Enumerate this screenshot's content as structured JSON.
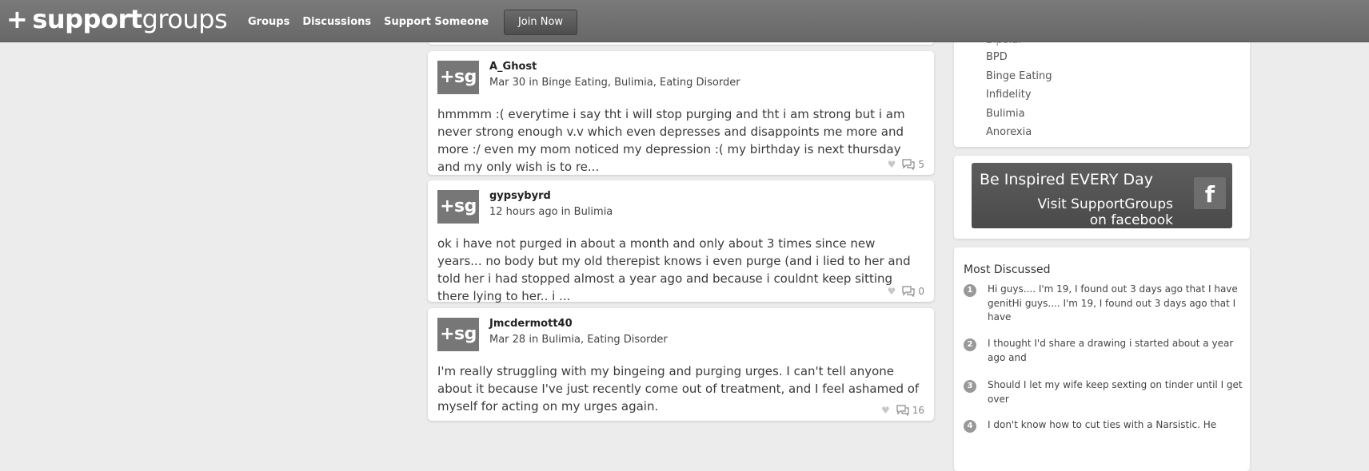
{
  "header": {
    "logo_plus": "+",
    "logo_bold": "support",
    "logo_light": "groups",
    "nav": [
      "Groups",
      "Discussions",
      "Support Someone"
    ],
    "join_label": "Join Now"
  },
  "posts": [
    {
      "avatar": "+sg",
      "user": "A_Ghost",
      "meta": "Mar 30 in Binge Eating, Bulimia, Eating Disorder",
      "body": "hmmmm :( everytime i say tht i will stop purging and tht i am strong but i am never strong enough v.v which even depresses and disappoints me more and more :/ even my mom noticed my depression :( my birthday is next thursday and my only wish is to re...",
      "comments": "5"
    },
    {
      "avatar": "+sg",
      "user": "gypsybyrd",
      "meta": "12 hours ago in Bulimia",
      "body": "ok i have not purged in about a month and only about 3 times since new years... no body but my old therepist knows i even purge (and i lied to her and told her i had stopped almost a year ago and because i couldnt keep sitting there lying to her.. i ...",
      "comments": "0"
    },
    {
      "avatar": "+sg",
      "user": "Jmcdermott40",
      "meta": "Mar 28 in Bulimia, Eating Disorder",
      "body": "I'm really struggling with my bingeing and purging urges. I can't tell anyone about it because I've just recently come out of treatment, and I feel ashamed of myself for acting on my urges again.",
      "comments": "16"
    }
  ],
  "sidebar": {
    "groups_cut": "Bipolar",
    "groups": [
      "BPD",
      "Binge Eating",
      "Infidelity",
      "Bulimia",
      "Anorexia"
    ],
    "fb_banner": {
      "line1": "Be Inspired EVERY Day",
      "line2": "Visit SupportGroups",
      "line3": "on facebook",
      "icon": "f"
    },
    "most_discussed_title": "Most Discussed",
    "most_discussed": [
      {
        "num": "1",
        "text": "Hi guys.... I'm 19, I found out 3 days ago that I have genitHi guys.... I'm 19, I found out 3 days ago that I have"
      },
      {
        "num": "2",
        "text": "I thought I'd share a drawing i started about a year ago and"
      },
      {
        "num": "3",
        "text": "Should I let my wife keep sexting on tinder until I get over"
      },
      {
        "num": "4",
        "text": "I don't know how to cut ties with a Narsistic. He"
      }
    ]
  },
  "colors": {
    "topbar": "#6f6f6f",
    "background": "#ececec",
    "avatar": "#777777",
    "banner": "#555555"
  }
}
